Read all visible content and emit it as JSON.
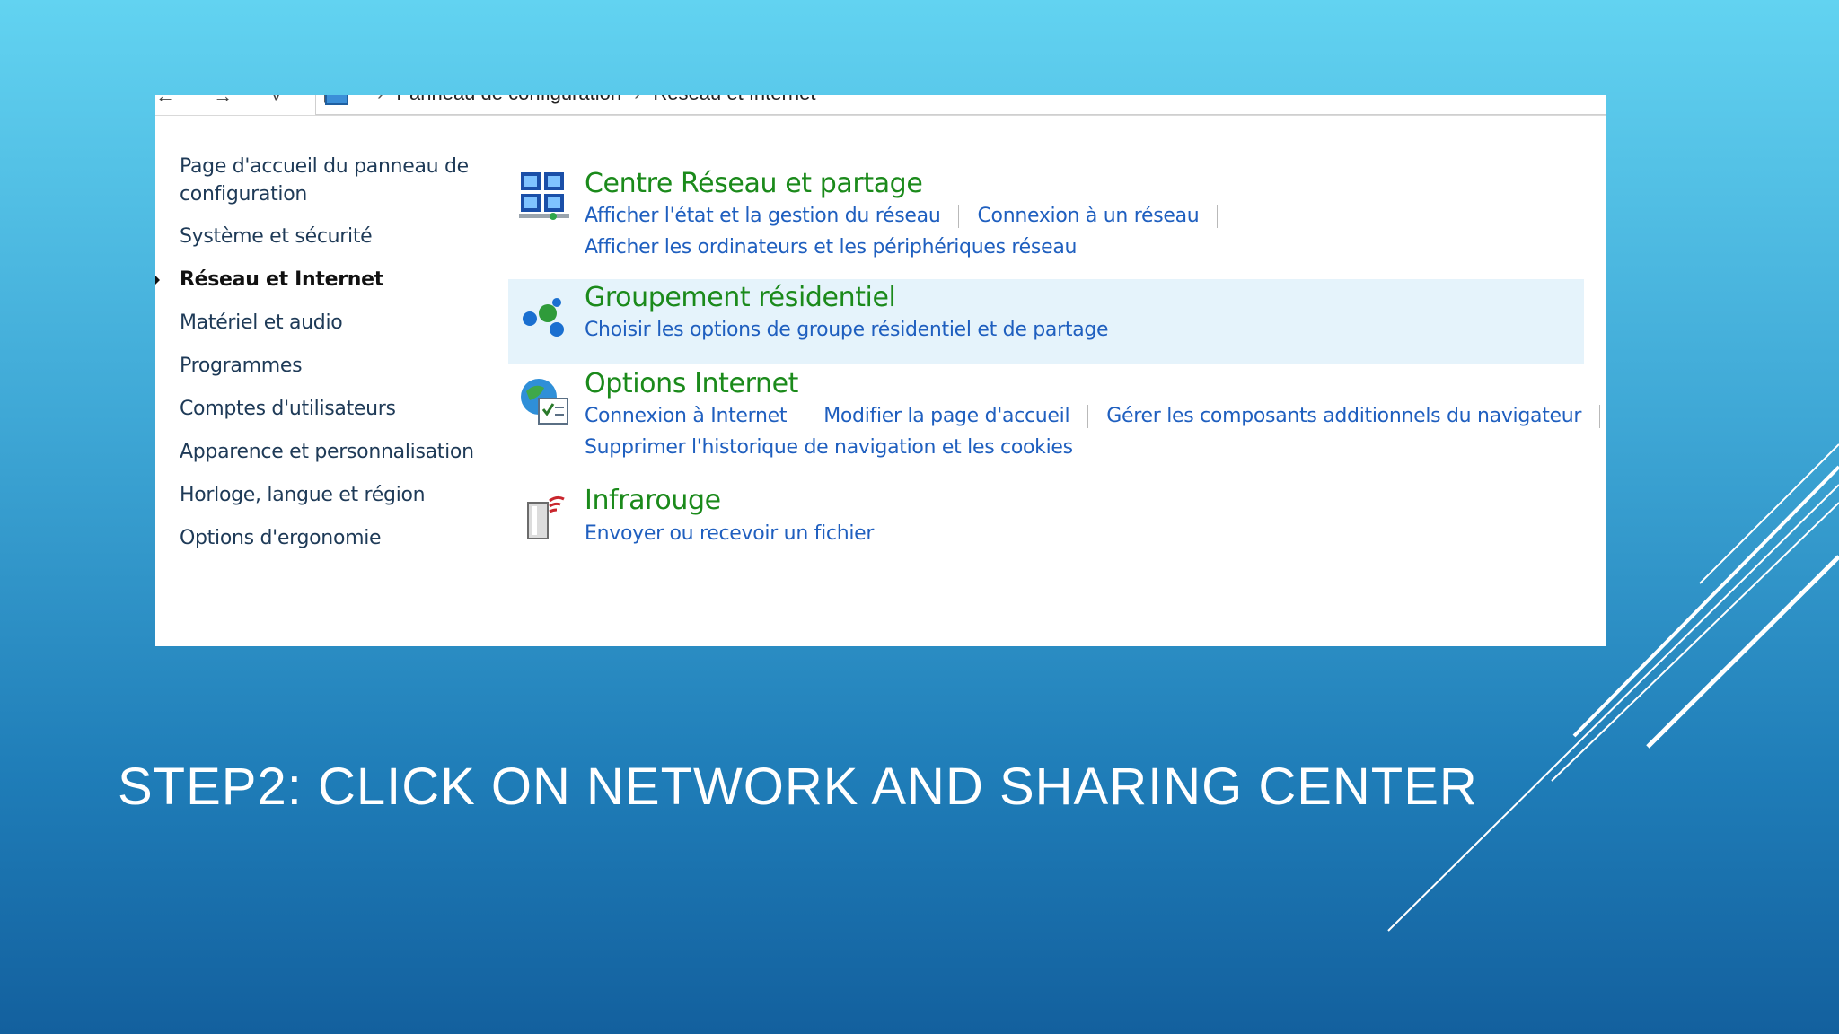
{
  "address_bar": {
    "nav_arrows": "← → ˅ ↑",
    "path": [
      "Panneau de configuration",
      "Réseau et Internet"
    ],
    "separator": "›"
  },
  "sidebar": {
    "items": [
      {
        "label": "Page d'accueil du panneau de configuration",
        "active": false
      },
      {
        "label": "Système et sécurité",
        "active": false
      },
      {
        "label": "Réseau et Internet",
        "active": true
      },
      {
        "label": "Matériel et audio",
        "active": false
      },
      {
        "label": "Programmes",
        "active": false
      },
      {
        "label": "Comptes d'utilisateurs",
        "active": false
      },
      {
        "label": "Apparence et personnalisation",
        "active": false
      },
      {
        "label": "Horloge, langue et région",
        "active": false
      },
      {
        "label": "Options d'ergonomie",
        "active": false
      }
    ]
  },
  "categories": [
    {
      "title": "Centre Réseau et partage",
      "icon": "network-center-icon",
      "links_line1": [
        "Afficher l'état et la gestion du réseau",
        "Connexion à un réseau"
      ],
      "links_line2": [
        "Afficher les ordinateurs et les périphériques réseau"
      ]
    },
    {
      "title": "Groupement résidentiel",
      "icon": "homegroup-icon",
      "highlighted": true,
      "links_line1": [
        "Choisir les options de groupe résidentiel et de partage"
      ]
    },
    {
      "title": "Options Internet",
      "icon": "internet-options-icon",
      "links_line1": [
        "Connexion à Internet",
        "Modifier la page d'accueil",
        "Gérer les composants additionnels du navigateur"
      ],
      "links_line2": [
        "Supprimer l'historique de navigation et les cookies"
      ]
    },
    {
      "title": "Infrarouge",
      "icon": "infrared-icon",
      "links_line1": [
        "Envoyer ou recevoir un fichier"
      ]
    }
  ],
  "slide": {
    "title": "STEP2: CLICK ON NETWORK AND SHARING CENTER"
  },
  "colors": {
    "category_title": "#1b8a1b",
    "link": "#1f5fbf",
    "highlight": "#e5f3fb",
    "background_top": "#62d3f1",
    "background_bottom": "#13609e"
  }
}
